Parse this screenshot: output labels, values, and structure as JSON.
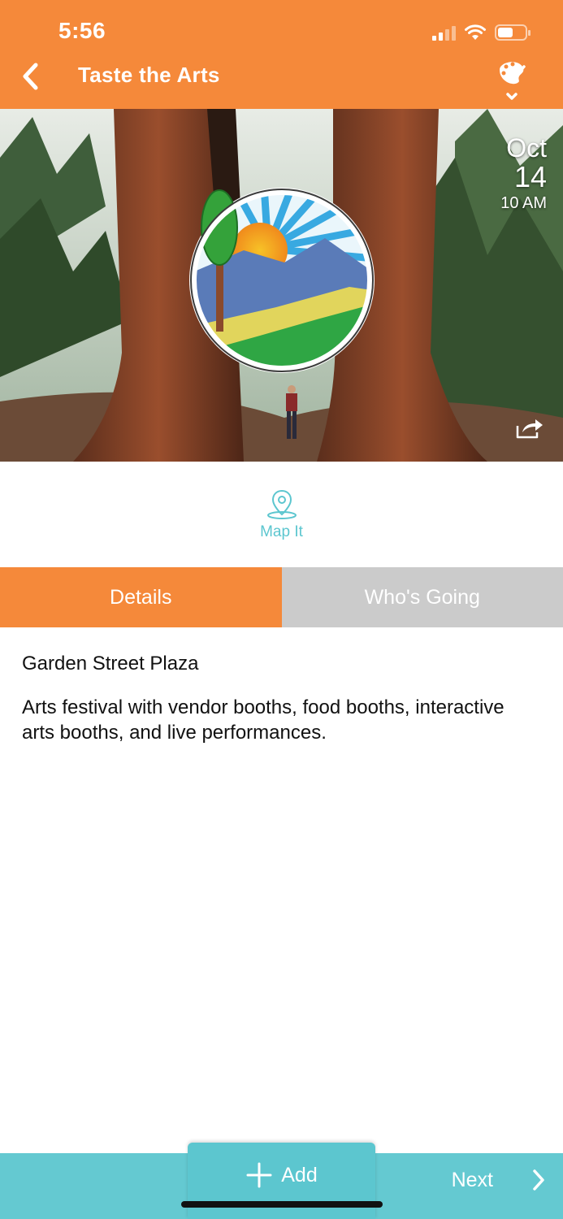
{
  "status_bar": {
    "time": "5:56",
    "icons": [
      "signal-icon",
      "wifi-icon",
      "battery-icon"
    ]
  },
  "header": {
    "title": "Taste the Arts",
    "back_icon": "chevron-left-icon",
    "menu_icon": "palette-icon"
  },
  "hero": {
    "date_month": "Oct",
    "date_day": "14",
    "date_time": "10 AM",
    "share_icon": "share-icon"
  },
  "map": {
    "label": "Map It",
    "icon": "map-pin-icon"
  },
  "tabs": [
    {
      "label": "Details",
      "active": true
    },
    {
      "label": "Who's Going",
      "active": false
    }
  ],
  "details": {
    "venue": "Garden Street Plaza",
    "description": "Arts festival with vendor booths, food booths, interactive arts booths, and live performances."
  },
  "bottom_bar": {
    "add_label": "Add",
    "next_label": "Next"
  },
  "colors": {
    "primary": "#f5893a",
    "accent": "#5cc6cf",
    "tab_inactive": "#cbcbcb"
  }
}
